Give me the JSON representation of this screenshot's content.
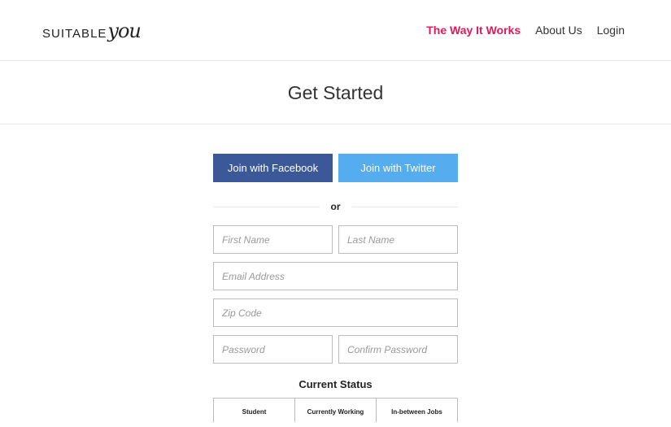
{
  "header": {
    "logo_main": "SUITABLE",
    "logo_script": "you",
    "nav": [
      {
        "label": "The Way It Works",
        "active": true
      },
      {
        "label": "About Us"
      },
      {
        "label": "Login"
      }
    ]
  },
  "page": {
    "title": "Get Started"
  },
  "social": {
    "facebook_label": "Join with Facebook",
    "twitter_label": "Join with Twitter",
    "or_text": "or"
  },
  "fields": {
    "first_name": "First Name",
    "last_name": "Last Name",
    "email": "Email Address",
    "zip": "Zip Code",
    "password": "Password",
    "confirm_password": "Confirm Password"
  },
  "status": {
    "title": "Current Status",
    "options": [
      "Student",
      "Currently Working",
      "In-between Jobs"
    ]
  },
  "colors": {
    "accent": "#e01a5a",
    "facebook": "#3b5998",
    "twitter": "#55acee"
  }
}
